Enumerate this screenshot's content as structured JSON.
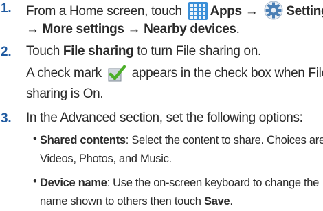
{
  "steps": [
    {
      "number": "1.",
      "text_a": "From a Home screen, touch",
      "apps_label": "Apps",
      "arrow1": "→",
      "settings_label": "Settings",
      "arrow2": "→",
      "more_settings": "More settings",
      "arrow3": "→",
      "nearby_devices": "Nearby devices",
      "period": "."
    },
    {
      "number": "2.",
      "text_a": "Touch",
      "file_sharing": "File sharing",
      "text_b": "to turn File sharing on.",
      "text_c": "A check mark",
      "text_d": "appears in the check box when File",
      "text_e": "sharing is On."
    },
    {
      "number": "3.",
      "text_a": "In the Advanced section, set the following options:",
      "options": [
        {
          "bullet": "•",
          "name": "Shared contents",
          "desc_1": ": Select the content to share. Choices are:",
          "desc_2": "Videos, Photos, and Music."
        },
        {
          "bullet": "•",
          "name": "Device name",
          "desc_1": ": Use the on-screen keyboard to change the",
          "desc_2": "name shown to others then touch",
          "action": "Save",
          "end": "."
        }
      ]
    }
  ],
  "icons": {
    "apps": "apps-grid-icon",
    "settings": "settings-gear-icon",
    "checkbox": "checkbox-checked-icon",
    "apps_color": "#3a8fd8",
    "check_color": "#4caf2a"
  }
}
